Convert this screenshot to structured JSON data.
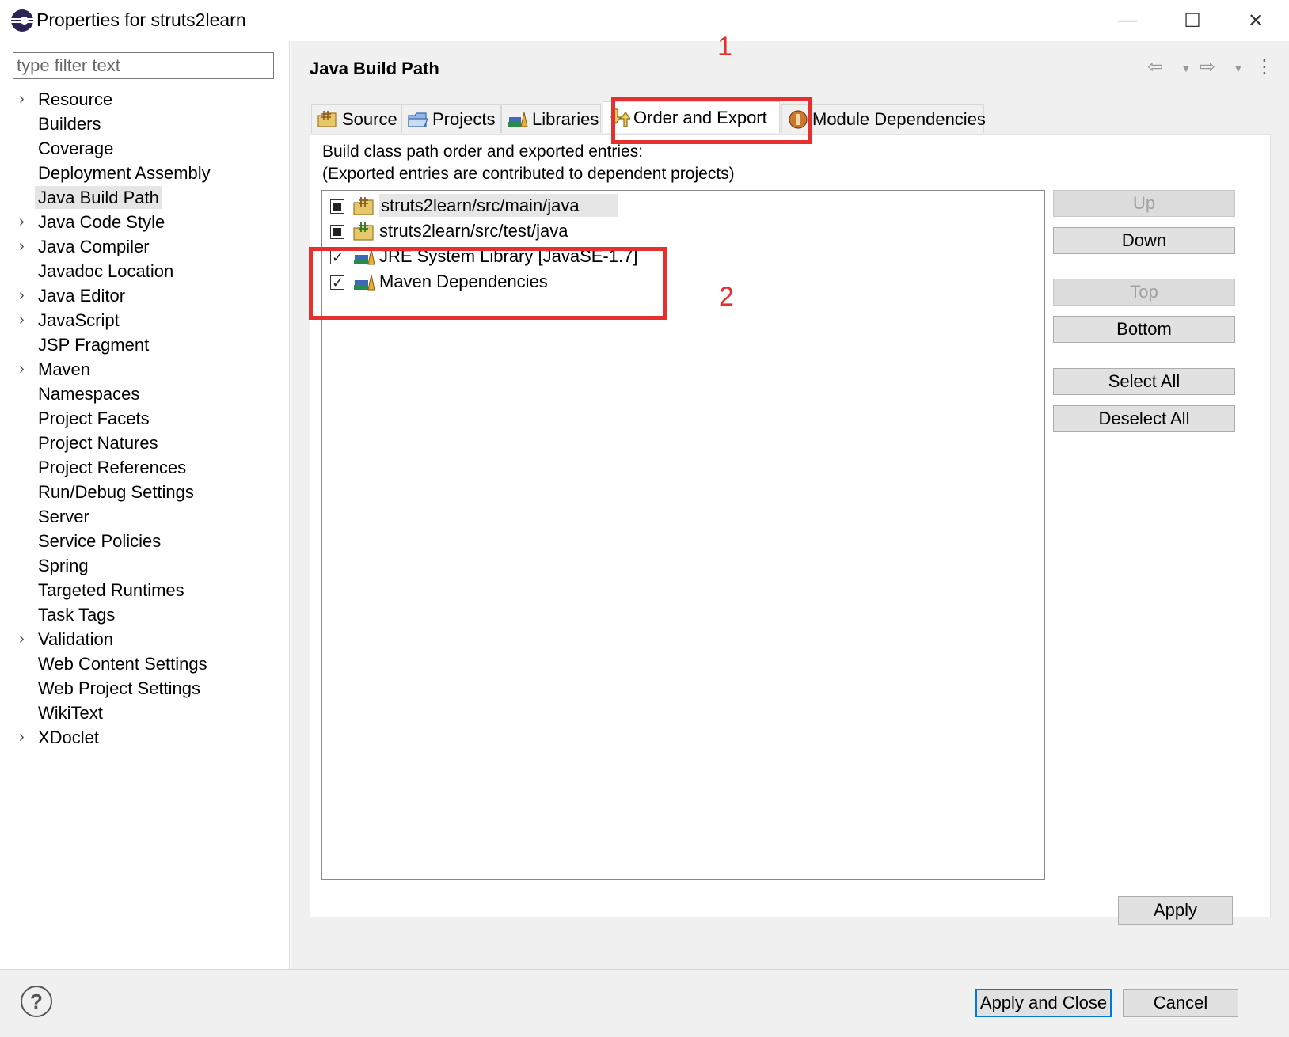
{
  "window": {
    "title": "Properties for struts2learn",
    "minimize_glyph": "—",
    "maximize_glyph": "☐",
    "close_glyph": "✕"
  },
  "filter": {
    "placeholder": "type filter text",
    "value": ""
  },
  "tree": {
    "items": [
      {
        "label": "Resource",
        "expandable": true
      },
      {
        "label": "Builders",
        "expandable": false
      },
      {
        "label": "Coverage",
        "expandable": false
      },
      {
        "label": "Deployment Assembly",
        "expandable": false
      },
      {
        "label": "Java Build Path",
        "expandable": false,
        "selected": true
      },
      {
        "label": "Java Code Style",
        "expandable": true
      },
      {
        "label": "Java Compiler",
        "expandable": true
      },
      {
        "label": "Javadoc Location",
        "expandable": false
      },
      {
        "label": "Java Editor",
        "expandable": true
      },
      {
        "label": "JavaScript",
        "expandable": true
      },
      {
        "label": "JSP Fragment",
        "expandable": false
      },
      {
        "label": "Maven",
        "expandable": true
      },
      {
        "label": "Namespaces",
        "expandable": false
      },
      {
        "label": "Project Facets",
        "expandable": false
      },
      {
        "label": "Project Natures",
        "expandable": false
      },
      {
        "label": "Project References",
        "expandable": false
      },
      {
        "label": "Run/Debug Settings",
        "expandable": false
      },
      {
        "label": "Server",
        "expandable": false
      },
      {
        "label": "Service Policies",
        "expandable": false
      },
      {
        "label": "Spring",
        "expandable": false
      },
      {
        "label": "Targeted Runtimes",
        "expandable": false
      },
      {
        "label": "Task Tags",
        "expandable": false
      },
      {
        "label": "Validation",
        "expandable": true
      },
      {
        "label": "Web Content Settings",
        "expandable": false
      },
      {
        "label": "Web Project Settings",
        "expandable": false
      },
      {
        "label": "WikiText",
        "expandable": false
      },
      {
        "label": "XDoclet",
        "expandable": true
      }
    ]
  },
  "page": {
    "title": "Java Build Path",
    "nav": {
      "back_icon": "back-arrow-icon",
      "forward_icon": "forward-arrow-icon",
      "menu_icon": "kebab-menu-icon"
    }
  },
  "tabs": [
    {
      "label": "Source",
      "icon": "source-folder-icon",
      "active": false
    },
    {
      "label": "Projects",
      "icon": "projects-folder-icon",
      "active": false
    },
    {
      "label": "Libraries",
      "icon": "libraries-icon",
      "active": false
    },
    {
      "label": "Order and Export",
      "icon": "order-export-icon",
      "active": true
    },
    {
      "label": "Module Dependencies",
      "icon": "module-dependencies-icon",
      "active": false
    }
  ],
  "content": {
    "description_line1": "Build class path order and exported entries:",
    "description_line2": "(Exported entries are contributed to dependent projects)",
    "entries": [
      {
        "label": "struts2learn/src/main/java",
        "checkbox": "partial",
        "icon": "source-folder-icon",
        "highlighted": true
      },
      {
        "label": "struts2learn/src/test/java",
        "checkbox": "partial",
        "icon": "source-folder-icon",
        "highlighted": false
      },
      {
        "label": "JRE System Library [JavaSE-1.7]",
        "checkbox": "checked",
        "icon": "library-icon",
        "highlighted": false
      },
      {
        "label": "Maven Dependencies",
        "checkbox": "checked",
        "icon": "library-icon",
        "highlighted": false
      }
    ],
    "buttons": {
      "up": "Up",
      "down": "Down",
      "top": "Top",
      "bottom": "Bottom",
      "select_all": "Select All",
      "deselect_all": "Deselect All"
    },
    "apply": "Apply"
  },
  "footer": {
    "help_glyph": "?",
    "apply_and_close": "Apply and Close",
    "cancel": "Cancel"
  },
  "annotations": {
    "label1": "1",
    "label2": "2",
    "color": "#e63030"
  }
}
